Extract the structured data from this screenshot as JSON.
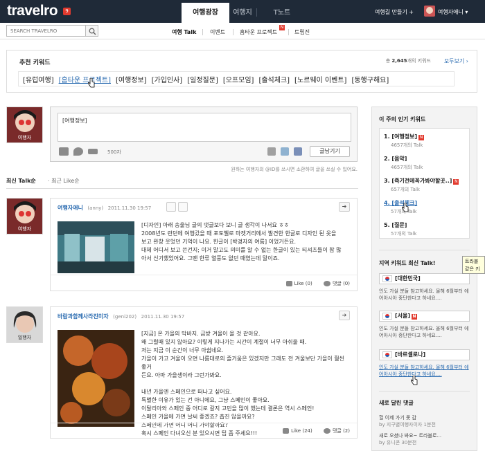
{
  "header": {
    "logo": "travelro",
    "logo_badge": "9",
    "tabs": [
      "여행광장",
      "여행지",
      "T노트"
    ],
    "make_trip": "여행길 만들기 +",
    "user_name": "여행자애니 ▾"
  },
  "subnav": {
    "search_placeholder": "SEARCH TRAVELRO",
    "items": [
      "여행 Talk",
      "이벤트",
      "홈타운 프로젝트",
      "트립진"
    ],
    "new_badge": "N"
  },
  "keywords": {
    "title": "추천 키워드",
    "count_prefix": "총",
    "count_value": "2,645",
    "count_suffix": "개의 키워드",
    "more": "모두보기 ›",
    "items": [
      "[유럽여행]",
      "[홈타운 프로젝트]",
      "[여행정보]",
      "[가입인사]",
      "[일정질문]",
      "[오프모임]",
      "[출석체크]",
      "[노르웨이 이벤트]",
      "[동행구해요]"
    ]
  },
  "composer": {
    "avatar_label": "여행자",
    "text": "[여행정보]",
    "char_count": "500자",
    "post_button": "글남기기",
    "note": "원하는 여행자의 @ID를 쓰시면 소환하여 글을 쓰실 수 있어요."
  },
  "sort": {
    "active": "최신 Talk순",
    "separator": "·",
    "other": "최근 Like순"
  },
  "posts": [
    {
      "avatar_label": "여행자",
      "author": "여행자애니",
      "handle": "(anny)",
      "time": "2011.11.30 19:57",
      "lines": [
        "[디자인] 아래 송울님 글의 댓글보다 보니 글 생각이 나서요 ㅎㅎ",
        "2008년도 런던에 여행갔을 때 포토벨로 마켓거리에서 발견한 한글로 디자인 된 옷을",
        "보고 완창 웃었던 기억이 나요. 한글이 [박경자의 여름] 이었거든요.",
        "대체 어디서 보고 쓴건지; 이거 말고도 의미를 알 수 없는 한글이 있는 티셔츠들이 참 많",
        "아서 신기했었어요. 그땐 한류 열풍도 없던 때였는데 말이죠."
      ],
      "like_label": "Like",
      "likes": "(0)",
      "comment_label": "댓글",
      "comments": "(0)"
    },
    {
      "avatar_label": "일행자",
      "author": "바람과함께사라진미자",
      "handle": "(geni202)",
      "time": "2011.11.30 19:57",
      "lines": [
        "[지금] 온 가을의 막바지. 금방 겨울이 올 것 같아요.",
        "왜 그럴때 있지 않아요? 이렇게 지나가는 시간이 계절이 너무 아쉬울 때.",
        "저는 지금 이 순간이 너무 아쉽네요.",
        "가을이 가고 겨울이 오면 나름대로의 즐거움은 있겠지만 그래도 전 겨울보단 가을이 훨씬 좋거",
        "든요. 아마 가을생이라 그런가봐요.",
        "",
        "내년 가을엔 스페인으로 떠나고 싶어요.",
        "특별한 이유가 있는 건 아니에요, 그냥 스페인이 좋아요.",
        "이탈리아와 스페인 중 어디로 갈지 고민을 많이 했는데 결론은 역시 스페인!",
        "스페인 가을에 가면 날씨 좋겠죠? 춥진 않을까요?",
        "스페인에 가면 어디 어디 가야할까요?",
        "혹시 스페인 다녀오신 분 있으시면 팁 좀 주세요!!!"
      ],
      "like_label": "Like",
      "likes": "(24)",
      "comment_label": "댓글",
      "comments": "(2)"
    }
  ],
  "sidebar": {
    "popular_title": "이 주의 인기 키워드",
    "popular": [
      {
        "rank": "1.",
        "keyword": "[여행정보]",
        "count": "4657개의 Talk",
        "new": true
      },
      {
        "rank": "2.",
        "keyword": "[음악]",
        "count": "4657개의 Talk",
        "new": false
      },
      {
        "rank": "3.",
        "keyword": "[즉기전에꼭가봐야할곳..]",
        "count": "657개의 Talk",
        "new": true
      },
      {
        "rank": "4.",
        "keyword": "[출석체크]",
        "count": "57개의 Talk",
        "new": false
      },
      {
        "rank": "5.",
        "keyword": "[질문]",
        "count": "57개의 Talk",
        "new": false
      }
    ],
    "new_badge": "N",
    "region_title": "지역 키워드 최신 Talk!",
    "tooltip_lines": [
      "트라블",
      "같은 키"
    ],
    "regions": [
      {
        "name": "[대한민국]",
        "desc": "인도 가실 분들 참고하세요. 올해 6월부터 에어아시아 중단한다고 하네요....",
        "new": false
      },
      {
        "name": "[서울]",
        "desc": "인도 가실 분들 참고하세요. 올해 6월부터 에어아시아 중단한다고 하네요....",
        "new": true
      },
      {
        "name": "[바르셀로나]",
        "desc": "인도 가실 분들 참고하세요. 올해 6월부터 에어아시아 중단한다고 하네요....",
        "new": false
      }
    ],
    "comments_title": "새로 달린 댓글",
    "comments": [
      {
        "text": "헐 이제 가기 못 감",
        "meta": "by 지구별여행자이자  1분전"
      },
      {
        "text": "새로 오셨나 봐요~ 트라블로...",
        "meta": "by 유니콘  30분전"
      }
    ]
  },
  "colors": {
    "topbar": "#1f2a38",
    "link": "#2a6bb0",
    "new_badge": "#e23a2e"
  }
}
